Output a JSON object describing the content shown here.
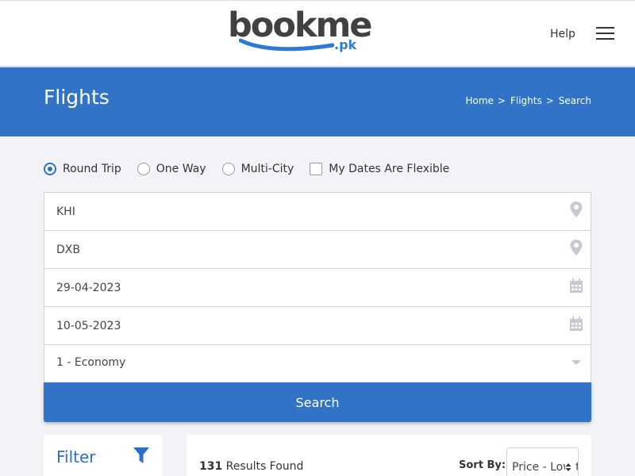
{
  "header": {
    "logo_main": "bookme",
    "logo_sub": ".pk",
    "help_label": "Help",
    "menu_icon": "hamburger-menu-icon"
  },
  "banner": {
    "title": "Flights",
    "breadcrumb": [
      "Home",
      "Flights",
      "Search"
    ],
    "separator": ">",
    "color": "#3173c6"
  },
  "trip_options": {
    "round_trip": "Round Trip",
    "one_way": "One Way",
    "multi_city": "Multi-City",
    "flexible": "My Dates Are Flexible",
    "selected": "Round Trip",
    "flexible_checked": false
  },
  "form": {
    "origin": "KHI",
    "destination": "DXB",
    "depart_date": "29-04-2023",
    "return_date": "10-05-2023",
    "travellers": "1 - Economy",
    "search_label": "Search"
  },
  "filter": {
    "title": "Filter",
    "icon": "funnel-icon"
  },
  "results": {
    "count": "131",
    "count_label": " Results Found",
    "sort_label": "Sort By:",
    "sort_value": "Price - Low to High"
  },
  "colors": {
    "accent": "#3173c6",
    "brand_blue": "#2c7ad6",
    "logo_grey": "#414141"
  }
}
